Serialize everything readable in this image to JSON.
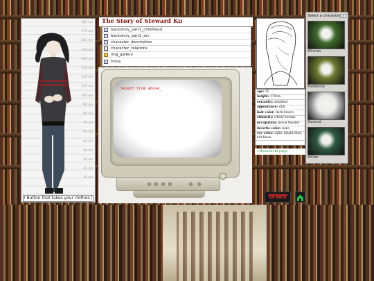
{
  "story": {
    "title": "The Story of Steward Ku",
    "files": [
      {
        "name": "backstory_part1_childhood",
        "icon": "document-icon"
      },
      {
        "name": "backstory_part2_arc",
        "icon": "document-icon"
      },
      {
        "name": "character_description",
        "icon": "document-icon"
      },
      {
        "name": "character_relations",
        "icon": "relations-icon"
      },
      {
        "name": "img_gallery",
        "icon": "folder-icon"
      },
      {
        "name": "trivia",
        "icon": "document-icon"
      }
    ]
  },
  "monitor": {
    "prompt": "Select from above_"
  },
  "character_panel": {
    "ruler_marks": [
      "180 cm",
      "170 cm",
      "160 cm",
      "150 cm",
      "140 cm",
      "130 cm",
      "120 cm",
      "110 cm",
      "100 cm",
      "90 cm",
      "80 cm",
      "70 cm",
      "60 cm",
      "50 cm",
      "40 cm",
      "30 cm",
      "20 cm",
      "10 cm"
    ],
    "clothes_button": "! Button that takes your clothes !"
  },
  "bio": [
    {
      "label": "age:",
      "value": "25"
    },
    {
      "label": "height:",
      "value": "179cm"
    },
    {
      "label": "sexuality:",
      "value": "unlabled"
    },
    {
      "label": "appearance:",
      "value": "slim"
    },
    {
      "label": "hair color:",
      "value": "dark brown"
    },
    {
      "label": "ethnicity:",
      "value": "white/ korean"
    },
    {
      "label": "occupation:",
      "value": "movie theater"
    },
    {
      "label": "favorite color:",
      "value": "none"
    },
    {
      "label": "eye color:",
      "value": "right: bright blue; left black"
    }
  ],
  "household_link": "<Household page",
  "selector": {
    "heading": "Select a character:",
    "close_label": "x",
    "characters": [
      {
        "name": "Winston",
        "tint": "#3f6a2c"
      },
      {
        "name": "Madeleine",
        "tint": "#6c7a32"
      },
      {
        "name": "Steward",
        "tint": "#e8e8e8"
      },
      {
        "name": "Walter",
        "tint": "#2f5a40"
      }
    ]
  },
  "buttons": {
    "go_back": "GO BACK"
  },
  "colors": {
    "title_red": "#7a1010",
    "prompt_red": "#d01010",
    "link_green": "#2a8a4a"
  }
}
